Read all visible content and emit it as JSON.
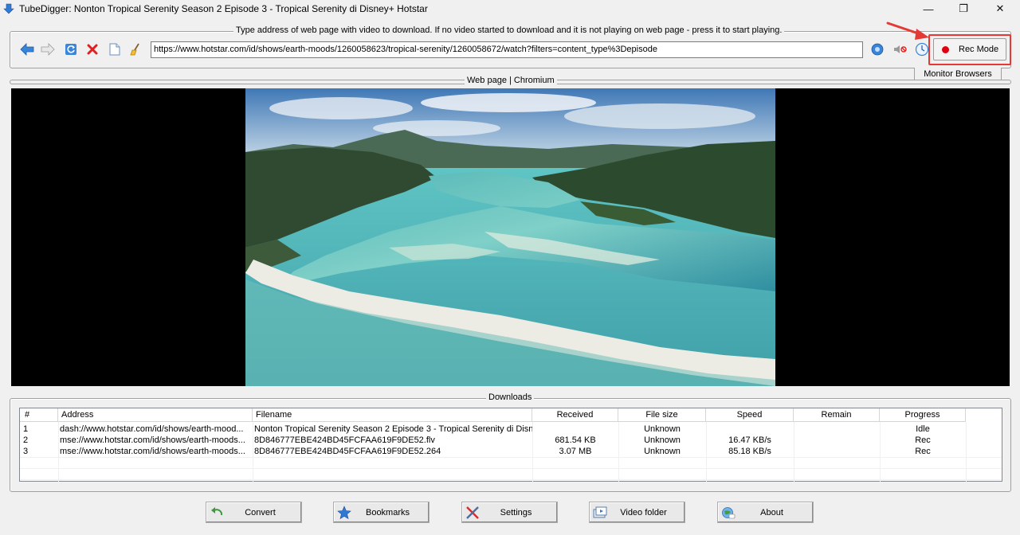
{
  "window": {
    "title": "TubeDigger: Nonton Tropical Serenity Season 2 Episode 3 - Tropical Serenity di Disney+ Hotstar",
    "minimize": "—",
    "maximize": "❐",
    "close": "✕"
  },
  "address_group": {
    "title": "Type address of web page with video to download. If no video started to download and it is not playing on web page - press it to start playing.",
    "url": "https://www.hotstar.com/id/shows/earth-moods/1260058623/tropical-serenity/1260058672/watch?filters=content_type%3Depisode",
    "rec_mode_label": "Rec Mode",
    "monitor_browsers_label": "Monitor Browsers"
  },
  "toolbar": {
    "icons": [
      "back-arrow-icon",
      "forward-arrow-icon",
      "refresh-icon",
      "stop-icon",
      "page-icon",
      "clear-broom-icon",
      "go-icon",
      "mute-icon",
      "timer-icon"
    ]
  },
  "web_page": {
    "title": "Web page | Chromium"
  },
  "downloads": {
    "title": "Downloads",
    "columns": [
      "#",
      "Address",
      "Filename",
      "Received",
      "File size",
      "Speed",
      "Remain",
      "Progress"
    ],
    "rows": [
      {
        "num": "1",
        "address": "dash://www.hotstar.com/id/shows/earth-mood...",
        "filename": "Nonton Tropical Serenity Season 2 Episode 3 - Tropical Serenity di Disn...",
        "received": "",
        "filesize": "Unknown",
        "speed": "",
        "remain": "",
        "progress": "Idle"
      },
      {
        "num": "2",
        "address": "mse://www.hotstar.com/id/shows/earth-moods...",
        "filename": "8D846777EBE424BD45FCFAA619F9DE52.flv",
        "received": "681.54 KB",
        "filesize": "Unknown",
        "speed": "16.47 KB/s",
        "remain": "",
        "progress": "Rec"
      },
      {
        "num": "3",
        "address": "mse://www.hotstar.com/id/shows/earth-moods...",
        "filename": "8D846777EBE424BD45FCFAA619F9DE52.264",
        "received": "3.07 MB",
        "filesize": "Unknown",
        "speed": "85.18 KB/s",
        "remain": "",
        "progress": "Rec"
      }
    ]
  },
  "bottom_buttons": {
    "convert": "Convert",
    "bookmarks": "Bookmarks",
    "settings": "Settings",
    "video_folder": "Video folder",
    "about": "About"
  },
  "colors": {
    "highlight": "#e53935",
    "rec_dot": "#e00010"
  }
}
